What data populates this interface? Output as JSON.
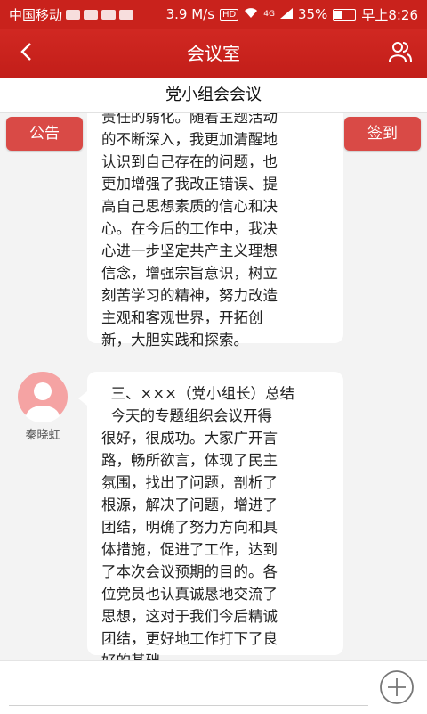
{
  "status_bar": {
    "carrier": "中国移动",
    "speed": "3.9 M/s",
    "hd": "HD",
    "signal": "4G",
    "battery": "35%",
    "time": "早上8:26"
  },
  "header": {
    "title": "会议室",
    "back_icon": "chevron-left-icon",
    "members_icon": "people-icon"
  },
  "meeting": {
    "subject": "党小组会会议"
  },
  "actions": {
    "notice_label": "公告",
    "signin_label": "签到"
  },
  "messages": [
    {
      "lines": [
        "责任的弱化。随着主题活动",
        "的不断深入，我更加清醒地",
        "认识到自己存在的问题，也",
        "更加增强了我改正错误、提",
        "高自己思想素质的信心和决",
        "心。在今后的工作中，我决",
        "心进一步坚定共产主义理想",
        "信念，增强宗旨意识，树立",
        "刻苦学习的精神，努力改造",
        "主观和客观世界，开拓创",
        "新，大胆实践和探索。"
      ]
    },
    {
      "sender": "秦晓虹",
      "avatar_icon": "user-avatar-icon",
      "lines": [
        "  三、×××（党小组长）总结",
        "  今天的专题组织会议开得",
        "很好，很成功。大家广开言",
        "路，畅所欲言，体现了民主",
        "氛围，找出了问题，剖析了",
        "根源，解决了问题，增进了",
        "团结，明确了努力方向和具",
        "体措施，促进了工作，达到",
        "了本次会议预期的目的。各",
        "位党员也认真诚恳地交流了",
        "思想，这对于我们今后精诚",
        "团结，更好地工作打下了良",
        "好的基础。"
      ]
    }
  ],
  "input": {
    "placeholder": "",
    "value": "",
    "add_icon": "plus-circle-icon"
  },
  "colors": {
    "primary_red": "#c9221c",
    "button_red": "#d94a46",
    "avatar_pink": "#f5a3a3"
  }
}
